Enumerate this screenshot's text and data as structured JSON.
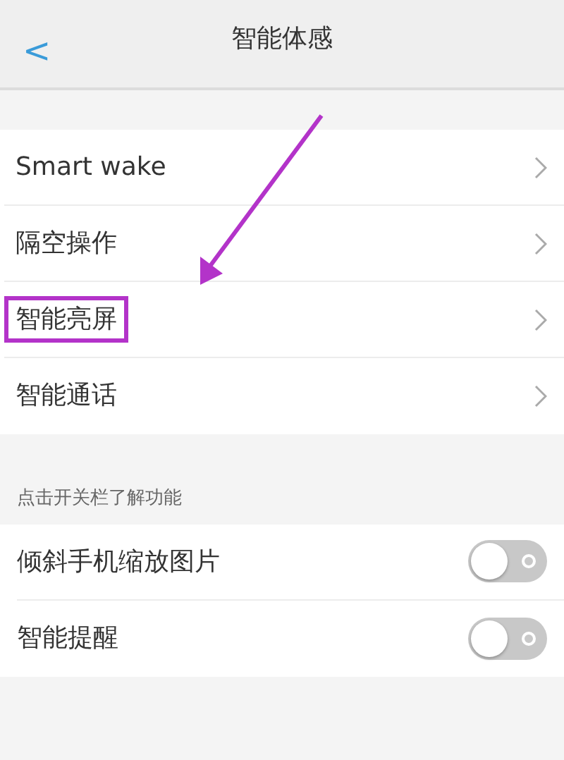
{
  "header": {
    "back": "<",
    "title": "智能体感"
  },
  "items": [
    {
      "label": "Smart wake",
      "highlighted": false
    },
    {
      "label": "隔空操作",
      "highlighted": false
    },
    {
      "label": "智能亮屏",
      "highlighted": true
    },
    {
      "label": "智能通话",
      "highlighted": false
    }
  ],
  "section_label": "点击开关栏了解功能",
  "toggles": [
    {
      "label": "倾斜手机缩放图片",
      "on": false
    },
    {
      "label": "智能提醒",
      "on": false
    }
  ]
}
